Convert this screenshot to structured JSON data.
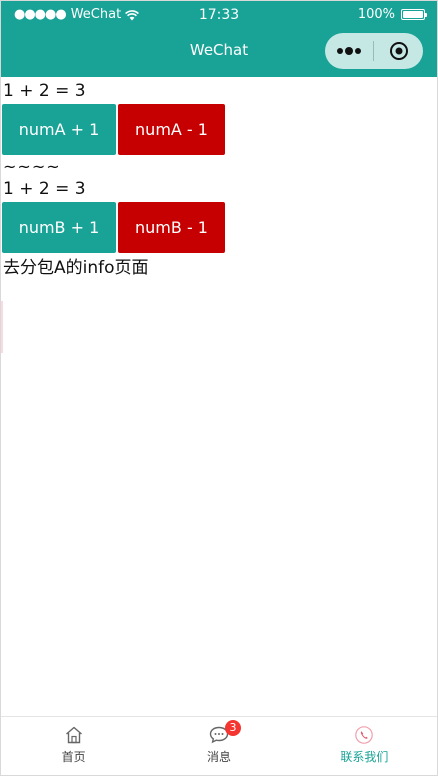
{
  "status_bar": {
    "signal_dots": "●●●●●",
    "carrier": "WeChat",
    "time": "17:33",
    "battery": "100%"
  },
  "nav": {
    "title": "WeChat"
  },
  "content": {
    "line_a": "1 + 2 = 3",
    "btn_numA_plus": "numA + 1",
    "btn_numA_minus": "numA - 1",
    "separator": "~~~~",
    "line_b": "1 + 2 = 3",
    "btn_numB_plus": "numB + 1",
    "btn_numB_minus": "numB - 1",
    "link_info": "去分包A的info页面"
  },
  "tabbar": {
    "items": [
      {
        "label": "首页",
        "icon": "home-icon"
      },
      {
        "label": "消息",
        "icon": "chat-icon",
        "badge": "3"
      },
      {
        "label": "联系我们",
        "icon": "phone-icon"
      }
    ],
    "active_index": 2
  },
  "colors": {
    "primary": "#18a396",
    "warn": "#c60000",
    "badge": "#f43530"
  }
}
